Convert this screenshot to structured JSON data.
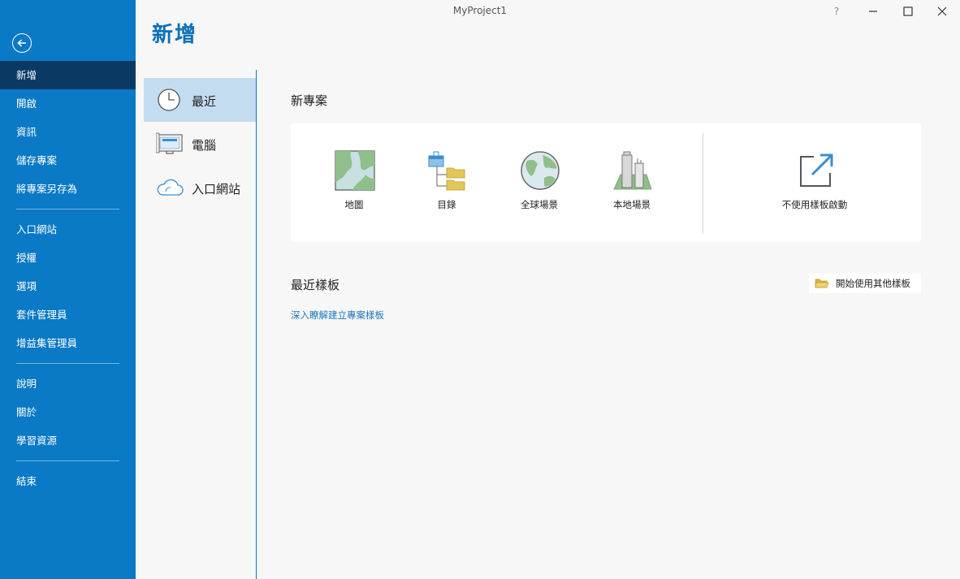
{
  "window": {
    "title": "MyProject1",
    "help_label": "?",
    "minimize_label": "—",
    "maximize_label": "☐",
    "close_label": "✕"
  },
  "rail": {
    "items": [
      {
        "label": "新增"
      },
      {
        "label": "開啟"
      },
      {
        "label": "資訊"
      },
      {
        "label": "儲存專案"
      },
      {
        "label": "將專案另存為"
      },
      {
        "label": "入口網站"
      },
      {
        "label": "授權"
      },
      {
        "label": "選項"
      },
      {
        "label": "套件管理員"
      },
      {
        "label": "增益集管理員"
      },
      {
        "label": "說明"
      },
      {
        "label": "關於"
      },
      {
        "label": "學習資源"
      },
      {
        "label": "結束"
      }
    ]
  },
  "page": {
    "title": "新增"
  },
  "sources": {
    "items": [
      {
        "label": "最近",
        "icon": "clock-icon"
      },
      {
        "label": "電腦",
        "icon": "computer-icon"
      },
      {
        "label": "入口網站",
        "icon": "cloud-icon"
      }
    ]
  },
  "new_project": {
    "title": "新專案",
    "templates": [
      {
        "label": "地圖",
        "icon": "map-template-icon"
      },
      {
        "label": "目錄",
        "icon": "catalog-template-icon"
      },
      {
        "label": "全球場景",
        "icon": "global-scene-icon"
      },
      {
        "label": "本地場景",
        "icon": "local-scene-icon"
      }
    ],
    "no_template_label": "不使用樣板啟動"
  },
  "recent_templates": {
    "title": "最近樣板",
    "other_templates_label": "開始使用其他樣板",
    "learn_link": "深入瞭解建立專案樣板"
  },
  "colors": {
    "rail": "#0a79c6",
    "rail_active": "#0a3a64",
    "accent": "#0a6fb8",
    "link": "#1b76c0",
    "source_active": "#c4dcef"
  }
}
